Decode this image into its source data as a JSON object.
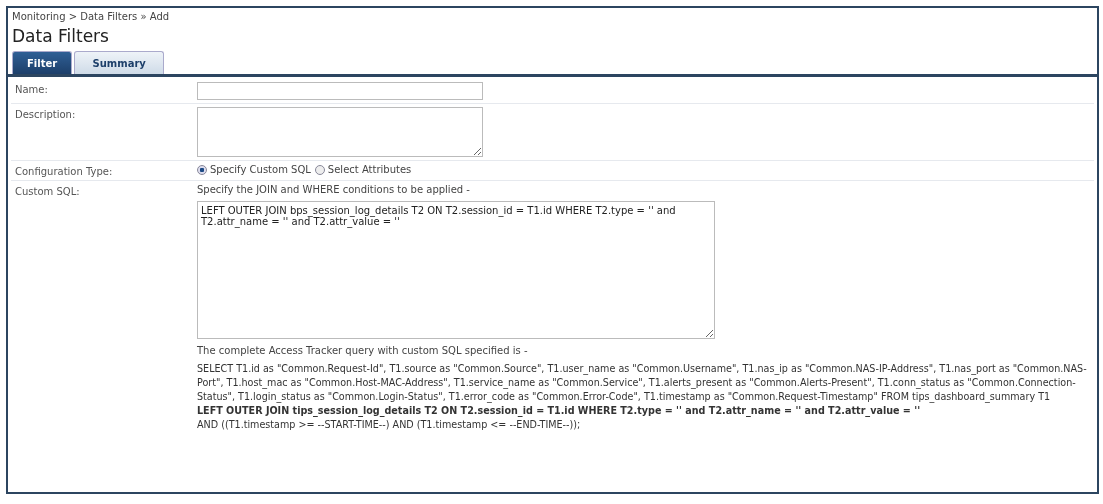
{
  "breadcrumb": "Monitoring > Data Filters » Add",
  "title": "Data Filters",
  "tabs": [
    {
      "label": "Filter",
      "selected": true
    },
    {
      "label": "Summary",
      "selected": false
    }
  ],
  "form": {
    "name": {
      "label": "Name:"
    },
    "description": {
      "label": "Description:"
    },
    "configuration_type": {
      "label": "Configuration Type:",
      "options": [
        {
          "label": "Specify Custom SQL",
          "selected": true
        },
        {
          "label": "Select Attributes",
          "selected": false
        }
      ]
    },
    "custom_sql": {
      "label": "Custom SQL:",
      "hint": "Specify the JOIN and WHERE conditions to be applied -",
      "value": "LEFT OUTER JOIN bps_session_log_details T2 ON T2.session_id = T1.id WHERE T2.type = '' and T2.attr_name = '' and T2.attr_value = ''",
      "query_intro": "The complete Access Tracker query with custom SQL specified is -",
      "query": [
        {
          "kind": "plain",
          "text": "SELECT T1.id as \"Common.Request-Id\", T1.source as \"Common.Source\", T1.user_name as \"Common.Username\", T1.nas_ip as \"Common.NAS-IP-Address\", T1.nas_port as \"Common.NAS-Port\", T1.host_mac as \"Common.Host-MAC-Address\", T1.service_name as \"Common.Service\", T1.alerts_present as \"Common.Alerts-Present\", T1.conn_status as \"Common.Connection-Status\", T1.login_status as \"Common.Login-Status\", T1.error_code as \"Common.Error-Code\", T1.timestamp as \"Common.Request-Timestamp\" FROM tips_dashboard_summary T1"
        },
        {
          "kind": "bold",
          "text": "LEFT OUTER JOIN tips_session_log_details T2 ON T2.session_id = T1.id WHERE T2.type = '' and T2.attr_name = '' and T2.attr_value = ''"
        },
        {
          "kind": "plain",
          "text": "AND ((T1.timestamp >= --START-TIME--) AND (T1.timestamp <= --END-TIME--));"
        }
      ]
    }
  }
}
